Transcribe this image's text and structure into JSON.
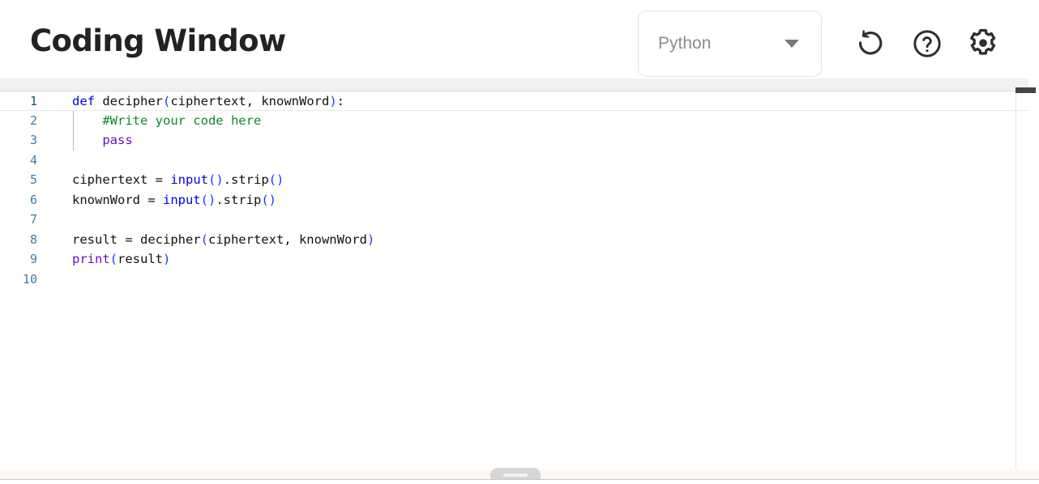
{
  "header": {
    "title": "Coding Window",
    "language_select": {
      "value": "Python",
      "caret_icon": "chevron-down-icon"
    },
    "actions": [
      {
        "name": "reset-button",
        "icon": "reset-circular-arrow-icon",
        "label": "Reset"
      },
      {
        "name": "help-button",
        "icon": "question-mark-circle-icon",
        "label": "Help"
      },
      {
        "name": "settings-button",
        "icon": "gear-icon",
        "label": "Settings"
      }
    ]
  },
  "editor": {
    "language": "Python",
    "active_line": 1,
    "scrollbar": {
      "name": "vertical-scrollbar-thumb",
      "position": "top"
    },
    "lines": [
      {
        "number": "1",
        "indent_guide": false,
        "tokens": [
          {
            "t": "def",
            "c": "t-kw"
          },
          {
            "t": " decipher",
            "c": "t-plain"
          },
          {
            "t": "(",
            "c": "t-paren"
          },
          {
            "t": "ciphertext, knownWord",
            "c": "t-plain"
          },
          {
            "t": ")",
            "c": "t-paren"
          },
          {
            "t": ":",
            "c": "t-plain"
          }
        ]
      },
      {
        "number": "2",
        "indent_guide": true,
        "tokens": [
          {
            "t": "    #Write your code here",
            "c": "t-comment"
          }
        ]
      },
      {
        "number": "3",
        "indent_guide": true,
        "tokens": [
          {
            "t": "    ",
            "c": "t-plain"
          },
          {
            "t": "pass",
            "c": "t-fnkw"
          }
        ]
      },
      {
        "number": "4",
        "indent_guide": false,
        "tokens": []
      },
      {
        "number": "5",
        "indent_guide": false,
        "tokens": [
          {
            "t": "ciphertext = ",
            "c": "t-plain"
          },
          {
            "t": "input",
            "c": "t-builtin"
          },
          {
            "t": "()",
            "c": "t-paren"
          },
          {
            "t": ".strip",
            "c": "t-plain"
          },
          {
            "t": "()",
            "c": "t-paren"
          }
        ]
      },
      {
        "number": "6",
        "indent_guide": false,
        "tokens": [
          {
            "t": "knownWord = ",
            "c": "t-plain"
          },
          {
            "t": "input",
            "c": "t-builtin"
          },
          {
            "t": "()",
            "c": "t-paren"
          },
          {
            "t": ".strip",
            "c": "t-plain"
          },
          {
            "t": "()",
            "c": "t-paren"
          }
        ]
      },
      {
        "number": "7",
        "indent_guide": false,
        "tokens": []
      },
      {
        "number": "8",
        "indent_guide": false,
        "tokens": [
          {
            "t": "result = decipher",
            "c": "t-plain"
          },
          {
            "t": "(",
            "c": "t-paren"
          },
          {
            "t": "ciphertext, knownWord",
            "c": "t-plain"
          },
          {
            "t": ")",
            "c": "t-paren"
          }
        ]
      },
      {
        "number": "9",
        "indent_guide": false,
        "tokens": [
          {
            "t": "print",
            "c": "t-fnkw"
          },
          {
            "t": "(",
            "c": "t-paren"
          },
          {
            "t": "result",
            "c": "t-plain"
          },
          {
            "t": ")",
            "c": "t-paren"
          }
        ]
      },
      {
        "number": "10",
        "indent_guide": false,
        "tokens": []
      }
    ]
  },
  "footer": {
    "resize_handle": {
      "name": "panel-resize-handle"
    }
  },
  "colors": {
    "keyword": "#0000ee",
    "builtin": "#0000ee",
    "function_keyword": "#6a0dc0",
    "paren": "#1a3bff",
    "comment": "#0f8a2e",
    "plain": "#111111",
    "gutter": "#3f7da3",
    "title": "#222222",
    "select_text": "#8d8d8d",
    "scrollbar_thumb": "#454545"
  }
}
